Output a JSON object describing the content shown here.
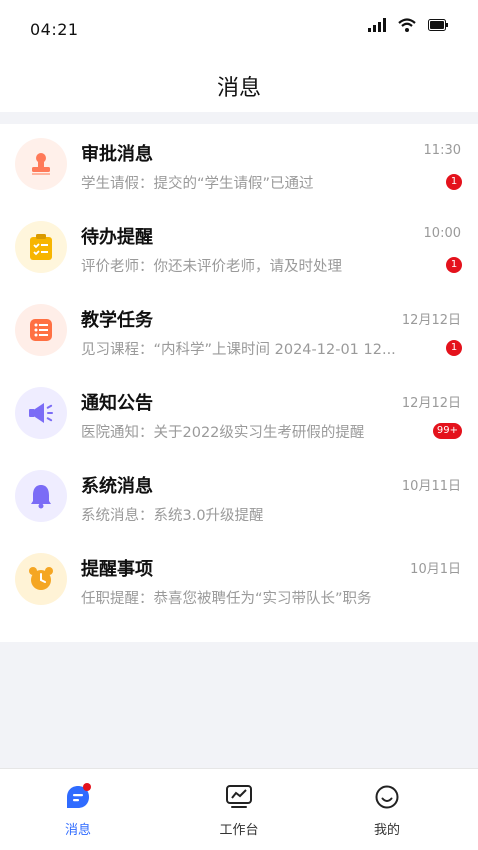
{
  "status_bar": {
    "time": "04:21"
  },
  "header": {
    "title": "消息"
  },
  "messages": [
    {
      "title": "审批消息",
      "subtitle": "学生请假：提交的“学生请假”已通过",
      "time": "11:30",
      "badge": "1",
      "icon": "stamp-icon",
      "color": "#ff7a59"
    },
    {
      "title": "待办提醒",
      "subtitle": "评价老师：你还未评价老师，请及时处理",
      "time": "10:00",
      "badge": "1",
      "icon": "clipboard-icon",
      "color": "#f7b500"
    },
    {
      "title": "教学任务",
      "subtitle": "见习课程：“内科学”上课时间 2024-12-01 12...",
      "time": "12月12日",
      "badge": "1",
      "icon": "task-list-icon",
      "color": "#ff7043"
    },
    {
      "title": "通知公告",
      "subtitle": "医院通知：关于2022级实习生考研假的提醒",
      "time": "12月12日",
      "badge": "99+",
      "icon": "megaphone-icon",
      "color": "#7b6cf6"
    },
    {
      "title": "系统消息",
      "subtitle": "系统消息：系统3.0升级提醒",
      "time": "10月11日",
      "badge": "",
      "icon": "bell-icon",
      "color": "#7b6cf6"
    },
    {
      "title": "提醒事项",
      "subtitle": "任职提醒：恭喜您被聘任为“实习带队长”职务",
      "time": "10月1日",
      "badge": "",
      "icon": "alarm-clock-icon",
      "color": "#f5a623"
    }
  ],
  "tabbar": {
    "items": [
      {
        "label": "消息",
        "icon": "message-icon",
        "active": true
      },
      {
        "label": "工作台",
        "icon": "workbench-icon",
        "active": false
      },
      {
        "label": "我的",
        "icon": "profile-icon",
        "active": false
      }
    ]
  },
  "colors": {
    "accent": "#2f6bff",
    "badge": "#e4121c",
    "background": "#f2f3f7"
  }
}
